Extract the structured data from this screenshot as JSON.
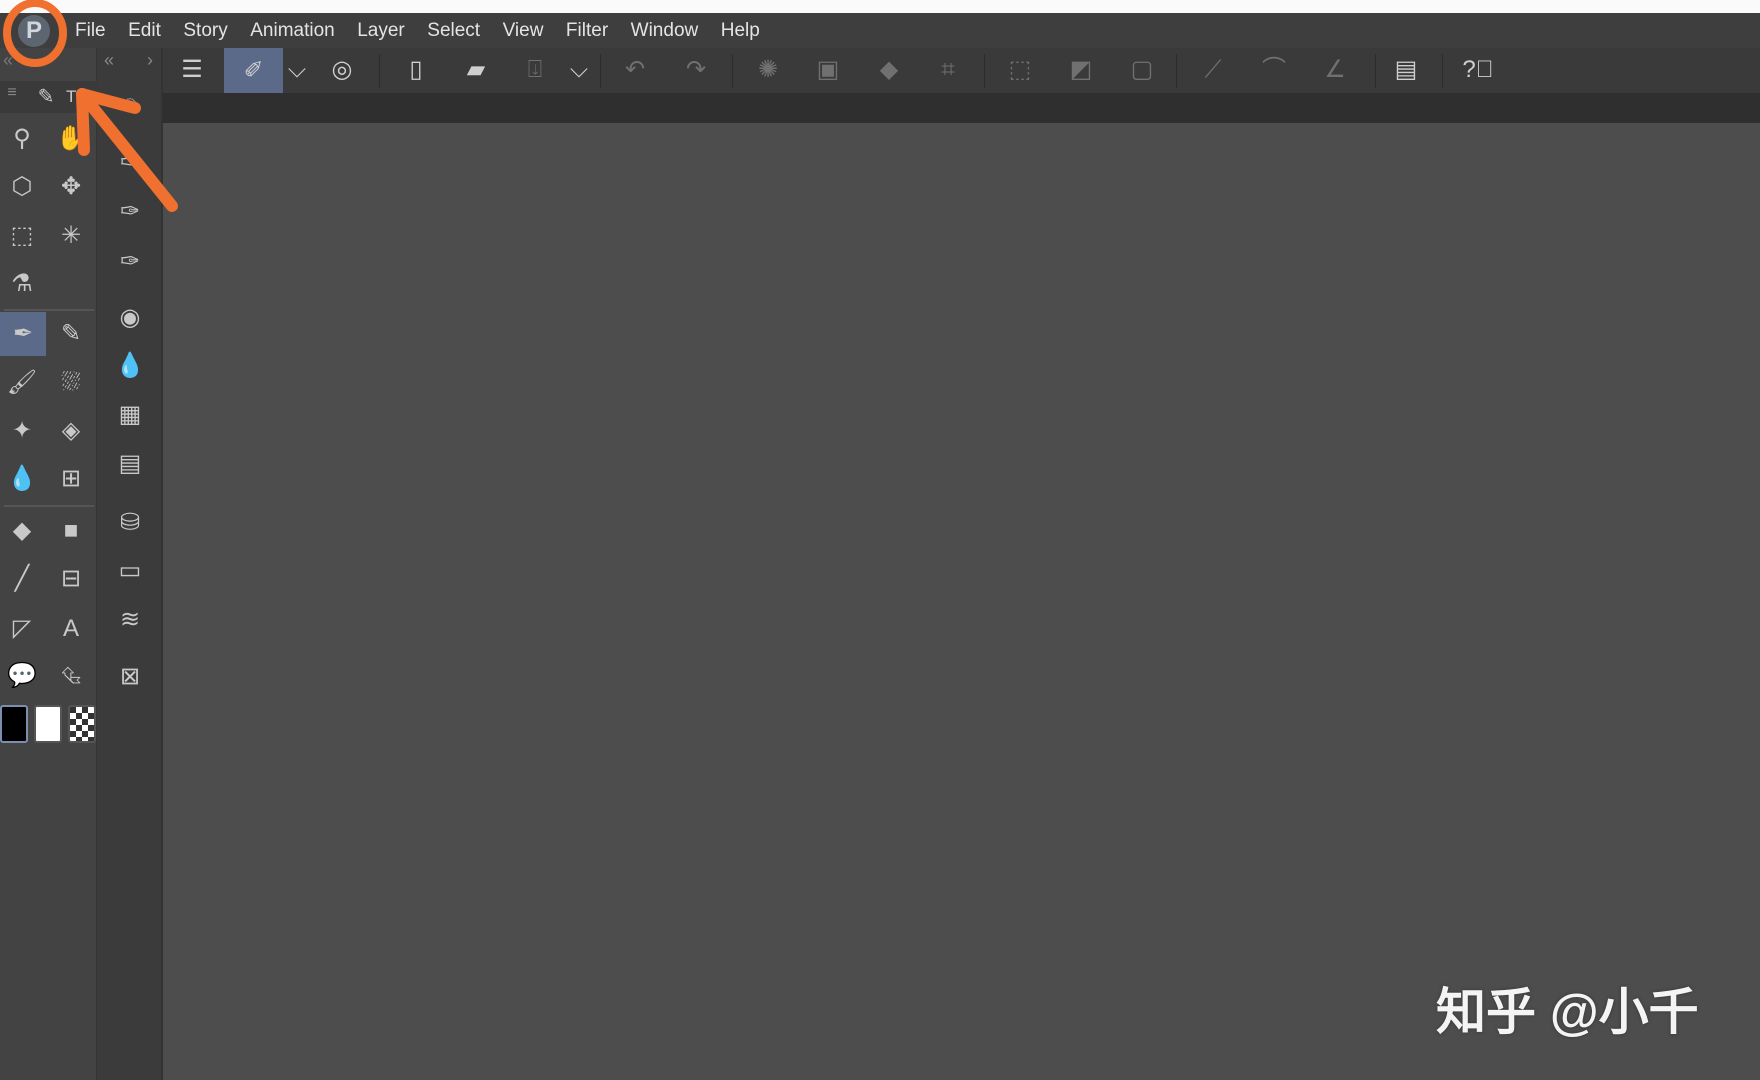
{
  "menubar": {
    "logo": "P",
    "items": [
      "File",
      "Edit",
      "Story",
      "Animation",
      "Layer",
      "Select",
      "View",
      "Filter",
      "Window",
      "Help"
    ]
  },
  "toolbar": {
    "items": [
      {
        "name": "menu-icon",
        "state": "normal"
      },
      {
        "name": "edit-layer-icon",
        "state": "selected"
      },
      {
        "name": "chevron-down-icon",
        "state": "normal"
      },
      {
        "name": "spiral-record-icon",
        "state": "normal"
      },
      {
        "name": "new-file-icon",
        "state": "normal"
      },
      {
        "name": "open-folder-icon",
        "state": "normal"
      },
      {
        "name": "save-icon",
        "state": "dim"
      },
      {
        "name": "chevron-down-icon",
        "state": "normal"
      },
      {
        "name": "undo-icon",
        "state": "dim"
      },
      {
        "name": "redo-icon",
        "state": "dim"
      },
      {
        "name": "loading-icon",
        "state": "dim"
      },
      {
        "name": "clear-icon",
        "state": "dim"
      },
      {
        "name": "fill-icon",
        "state": "dim"
      },
      {
        "name": "crop-icon",
        "state": "dim"
      },
      {
        "name": "deselect-icon",
        "state": "dim"
      },
      {
        "name": "invert-selection-icon",
        "state": "dim"
      },
      {
        "name": "selection-frame-icon",
        "state": "dim"
      },
      {
        "name": "ruler-snap-icon",
        "state": "dim"
      },
      {
        "name": "curve-snap-icon",
        "state": "dim"
      },
      {
        "name": "angle-snap-icon",
        "state": "dim"
      },
      {
        "name": "device-icon",
        "state": "normal"
      },
      {
        "name": "help-icon",
        "state": "normal"
      }
    ]
  },
  "panel_header": {
    "tab_label": "T",
    "menu_icon": "menu-icon",
    "tab_icon": "pencil-icon"
  },
  "tools": [
    "zoom-icon",
    "hand-icon",
    "3d-select-icon",
    "move-icon",
    "rect-select-icon",
    "magic-wand-icon",
    "eyedropper-icon",
    "",
    "pen-icon",
    "pencil-icon",
    "brush-icon",
    "airbrush-icon",
    "sparkle-decoration-icon",
    "eraser-icon",
    "blend-icon",
    "mesh-transform-icon",
    "fill-bucket-icon",
    "gradient-icon",
    "line-icon",
    "frame-border-icon",
    "ruler-icon",
    "text-icon",
    "balloon-icon",
    "link-select-icon"
  ],
  "selected_tool": "pen-icon",
  "colors": {
    "main": "#000000",
    "sub": "#ffffff",
    "transparent": "checker",
    "accent": "#5b6a89",
    "annotation": "#f07030"
  },
  "side_palette": [
    "tool-property-icon",
    "sub-tool-icon",
    "sub-tool-settings-icon",
    "sub-tool-detail-icon",
    "color-circle-icon",
    "color-blend-icon",
    "color-set-icon",
    "animation-timeline-icon",
    "layer-property-icon",
    "navigator-icon",
    "layers-icon",
    "material-icon"
  ],
  "watermark": "知乎 @小千"
}
